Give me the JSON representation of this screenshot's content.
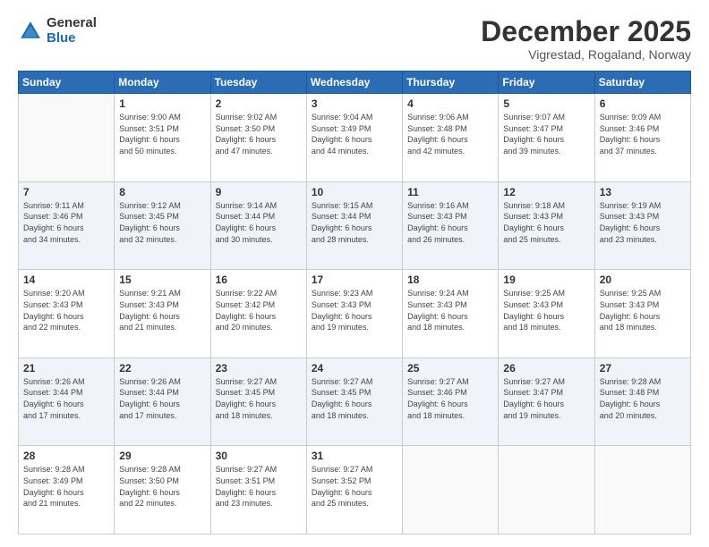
{
  "logo": {
    "line1": "General",
    "line2": "Blue"
  },
  "header": {
    "month": "December 2025",
    "location": "Vigrestad, Rogaland, Norway"
  },
  "weekdays": [
    "Sunday",
    "Monday",
    "Tuesday",
    "Wednesday",
    "Thursday",
    "Friday",
    "Saturday"
  ],
  "weeks": [
    [
      {
        "day": "",
        "info": ""
      },
      {
        "day": "1",
        "info": "Sunrise: 9:00 AM\nSunset: 3:51 PM\nDaylight: 6 hours\nand 50 minutes."
      },
      {
        "day": "2",
        "info": "Sunrise: 9:02 AM\nSunset: 3:50 PM\nDaylight: 6 hours\nand 47 minutes."
      },
      {
        "day": "3",
        "info": "Sunrise: 9:04 AM\nSunset: 3:49 PM\nDaylight: 6 hours\nand 44 minutes."
      },
      {
        "day": "4",
        "info": "Sunrise: 9:06 AM\nSunset: 3:48 PM\nDaylight: 6 hours\nand 42 minutes."
      },
      {
        "day": "5",
        "info": "Sunrise: 9:07 AM\nSunset: 3:47 PM\nDaylight: 6 hours\nand 39 minutes."
      },
      {
        "day": "6",
        "info": "Sunrise: 9:09 AM\nSunset: 3:46 PM\nDaylight: 6 hours\nand 37 minutes."
      }
    ],
    [
      {
        "day": "7",
        "info": "Sunrise: 9:11 AM\nSunset: 3:46 PM\nDaylight: 6 hours\nand 34 minutes."
      },
      {
        "day": "8",
        "info": "Sunrise: 9:12 AM\nSunset: 3:45 PM\nDaylight: 6 hours\nand 32 minutes."
      },
      {
        "day": "9",
        "info": "Sunrise: 9:14 AM\nSunset: 3:44 PM\nDaylight: 6 hours\nand 30 minutes."
      },
      {
        "day": "10",
        "info": "Sunrise: 9:15 AM\nSunset: 3:44 PM\nDaylight: 6 hours\nand 28 minutes."
      },
      {
        "day": "11",
        "info": "Sunrise: 9:16 AM\nSunset: 3:43 PM\nDaylight: 6 hours\nand 26 minutes."
      },
      {
        "day": "12",
        "info": "Sunrise: 9:18 AM\nSunset: 3:43 PM\nDaylight: 6 hours\nand 25 minutes."
      },
      {
        "day": "13",
        "info": "Sunrise: 9:19 AM\nSunset: 3:43 PM\nDaylight: 6 hours\nand 23 minutes."
      }
    ],
    [
      {
        "day": "14",
        "info": "Sunrise: 9:20 AM\nSunset: 3:43 PM\nDaylight: 6 hours\nand 22 minutes."
      },
      {
        "day": "15",
        "info": "Sunrise: 9:21 AM\nSunset: 3:43 PM\nDaylight: 6 hours\nand 21 minutes."
      },
      {
        "day": "16",
        "info": "Sunrise: 9:22 AM\nSunset: 3:42 PM\nDaylight: 6 hours\nand 20 minutes."
      },
      {
        "day": "17",
        "info": "Sunrise: 9:23 AM\nSunset: 3:43 PM\nDaylight: 6 hours\nand 19 minutes."
      },
      {
        "day": "18",
        "info": "Sunrise: 9:24 AM\nSunset: 3:43 PM\nDaylight: 6 hours\nand 18 minutes."
      },
      {
        "day": "19",
        "info": "Sunrise: 9:25 AM\nSunset: 3:43 PM\nDaylight: 6 hours\nand 18 minutes."
      },
      {
        "day": "20",
        "info": "Sunrise: 9:25 AM\nSunset: 3:43 PM\nDaylight: 6 hours\nand 18 minutes."
      }
    ],
    [
      {
        "day": "21",
        "info": "Sunrise: 9:26 AM\nSunset: 3:44 PM\nDaylight: 6 hours\nand 17 minutes."
      },
      {
        "day": "22",
        "info": "Sunrise: 9:26 AM\nSunset: 3:44 PM\nDaylight: 6 hours\nand 17 minutes."
      },
      {
        "day": "23",
        "info": "Sunrise: 9:27 AM\nSunset: 3:45 PM\nDaylight: 6 hours\nand 18 minutes."
      },
      {
        "day": "24",
        "info": "Sunrise: 9:27 AM\nSunset: 3:45 PM\nDaylight: 6 hours\nand 18 minutes."
      },
      {
        "day": "25",
        "info": "Sunrise: 9:27 AM\nSunset: 3:46 PM\nDaylight: 6 hours\nand 18 minutes."
      },
      {
        "day": "26",
        "info": "Sunrise: 9:27 AM\nSunset: 3:47 PM\nDaylight: 6 hours\nand 19 minutes."
      },
      {
        "day": "27",
        "info": "Sunrise: 9:28 AM\nSunset: 3:48 PM\nDaylight: 6 hours\nand 20 minutes."
      }
    ],
    [
      {
        "day": "28",
        "info": "Sunrise: 9:28 AM\nSunset: 3:49 PM\nDaylight: 6 hours\nand 21 minutes."
      },
      {
        "day": "29",
        "info": "Sunrise: 9:28 AM\nSunset: 3:50 PM\nDaylight: 6 hours\nand 22 minutes."
      },
      {
        "day": "30",
        "info": "Sunrise: 9:27 AM\nSunset: 3:51 PM\nDaylight: 6 hours\nand 23 minutes."
      },
      {
        "day": "31",
        "info": "Sunrise: 9:27 AM\nSunset: 3:52 PM\nDaylight: 6 hours\nand 25 minutes."
      },
      {
        "day": "",
        "info": ""
      },
      {
        "day": "",
        "info": ""
      },
      {
        "day": "",
        "info": ""
      }
    ]
  ]
}
